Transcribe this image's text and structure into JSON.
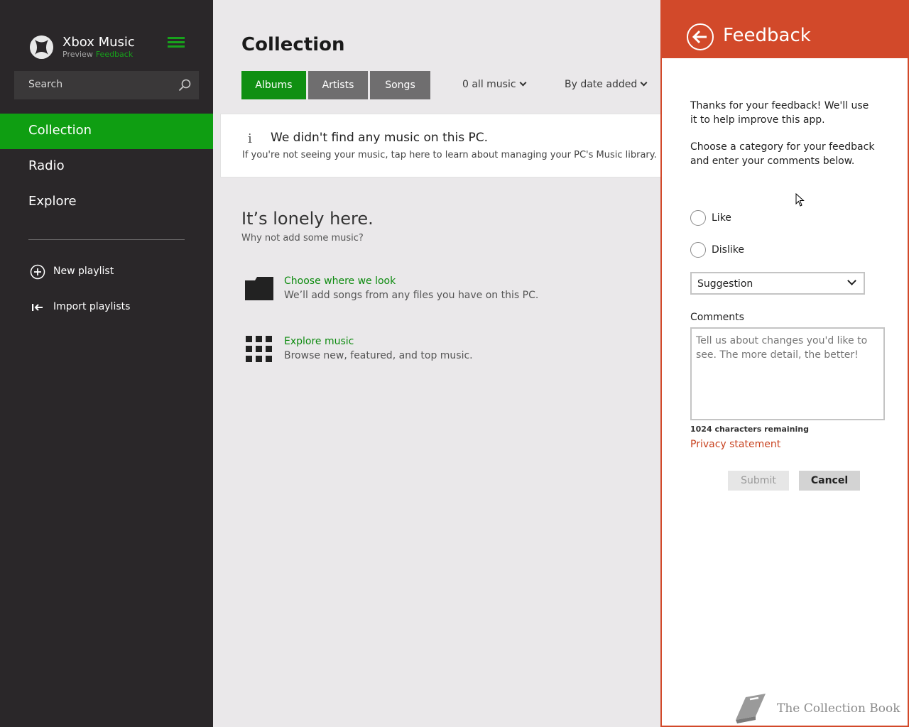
{
  "app": {
    "title": "Xbox Music",
    "subtitle": "Preview",
    "feedback_link": "Feedback"
  },
  "sidebar": {
    "search_placeholder": "Search",
    "nav": [
      {
        "label": "Collection",
        "active": true
      },
      {
        "label": "Radio",
        "active": false
      },
      {
        "label": "Explore",
        "active": false
      }
    ],
    "actions": [
      {
        "label": "New playlist",
        "icon": "plus-circle-icon"
      },
      {
        "label": "Import playlists",
        "icon": "import-icon"
      }
    ]
  },
  "main": {
    "title": "Collection",
    "tabs": [
      {
        "label": "Albums",
        "active": true
      },
      {
        "label": "Artists",
        "active": false
      },
      {
        "label": "Songs",
        "active": false
      }
    ],
    "filter": "0 all music",
    "sort": "By date added",
    "notice": {
      "icon": "i",
      "title": "We didn't find any music on this PC.",
      "body": "If you're not seeing your music, tap here to learn about managing your PC's Music library."
    },
    "empty": {
      "title": "It’s lonely here.",
      "subtitle": "Why not add some music?"
    },
    "actions": [
      {
        "title": "Choose where we look",
        "subtitle": "We’ll add songs from any files you have on this PC.",
        "icon": "folder-icon"
      },
      {
        "title": "Explore music",
        "subtitle": "Browse new, featured, and top music.",
        "icon": "grid-icon"
      }
    ]
  },
  "feedback": {
    "title": "Feedback",
    "intro": "Thanks for your feedback! We'll use it to help improve this app.",
    "instruction": "Choose a category for your feedback and enter your comments below.",
    "options": [
      "Like",
      "Dislike"
    ],
    "category": "Suggestion",
    "comments_label": "Comments",
    "comments_placeholder": "Tell us about changes you'd like to see. The more detail, the better!",
    "remaining": "1024 characters remaining",
    "privacy": "Privacy statement",
    "submit": "Submit",
    "cancel": "Cancel"
  },
  "watermark": "The Collection Book",
  "colors": {
    "accent_green": "#0f9e12",
    "sidebar_bg": "#2a2729",
    "main_bg": "#eae8ea",
    "feedback_orange": "#d2492a"
  }
}
